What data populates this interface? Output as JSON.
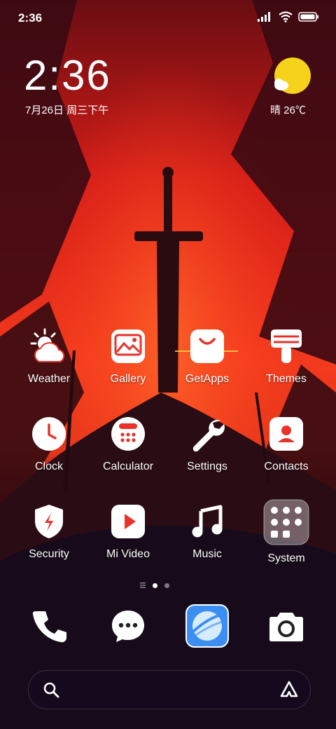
{
  "status_bar": {
    "time": "2:36"
  },
  "clock_widget": {
    "time": "2:36",
    "date": "7月26日 周三下午"
  },
  "weather_widget": {
    "text": "晴 26℃"
  },
  "apps": [
    {
      "label": "Weather",
      "icon": "weather-icon"
    },
    {
      "label": "Gallery",
      "icon": "gallery-icon"
    },
    {
      "label": "GetApps",
      "icon": "getapps-icon"
    },
    {
      "label": "Themes",
      "icon": "themes-icon"
    },
    {
      "label": "Clock",
      "icon": "clock-icon"
    },
    {
      "label": "Calculator",
      "icon": "calculator-icon"
    },
    {
      "label": "Settings",
      "icon": "settings-icon"
    },
    {
      "label": "Contacts",
      "icon": "contacts-icon"
    },
    {
      "label": "Security",
      "icon": "security-icon"
    },
    {
      "label": "Mi Video",
      "icon": "mi-video-icon"
    },
    {
      "label": "Music",
      "icon": "music-icon"
    },
    {
      "label": "System",
      "icon": "system-folder-icon"
    }
  ],
  "dock": [
    {
      "icon": "phone-icon"
    },
    {
      "icon": "messages-icon"
    },
    {
      "icon": "browser-icon"
    },
    {
      "icon": "camera-icon"
    }
  ],
  "search": {
    "placeholder": "",
    "icons": [
      "search-icon",
      "assistant-icon"
    ]
  },
  "colors": {
    "accent": "#e8322b",
    "sun": "#f7d21a",
    "browser": "#3a8ff0"
  }
}
